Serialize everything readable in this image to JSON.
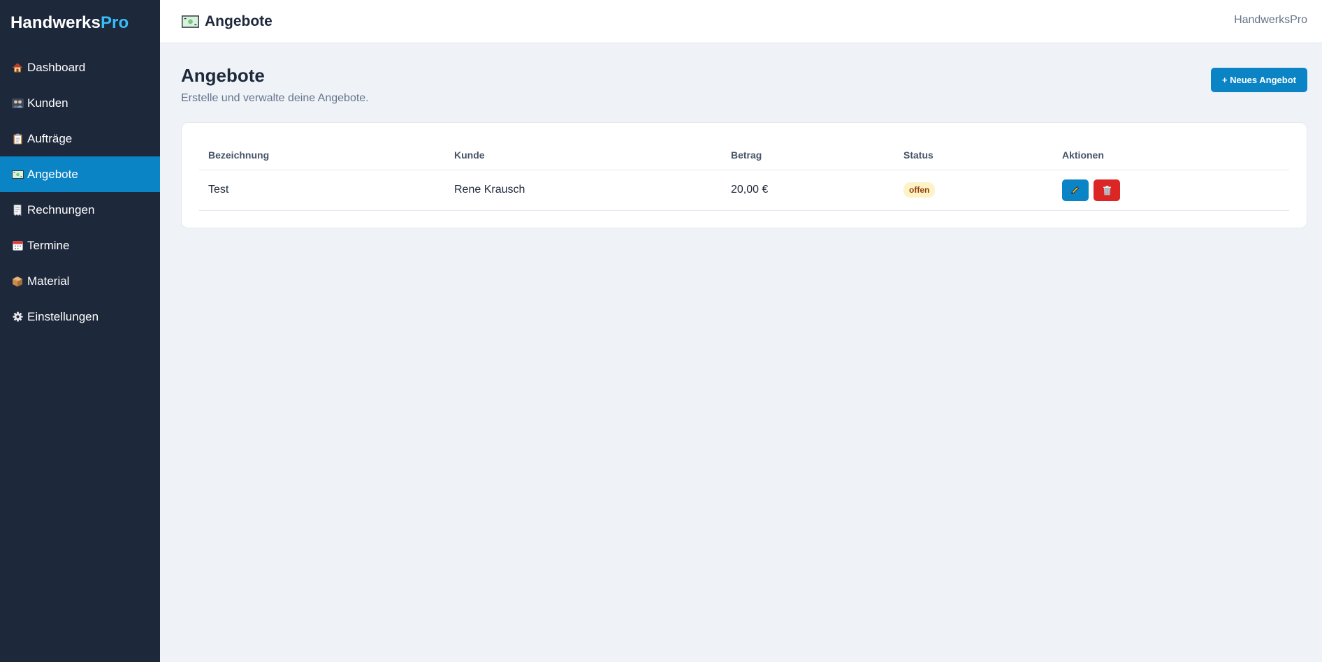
{
  "brand": {
    "main": "Handwerks",
    "accent": "Pro"
  },
  "sidebar": {
    "items": [
      {
        "label": "Dashboard",
        "icon": "house-icon",
        "active": false
      },
      {
        "label": "Kunden",
        "icon": "people-icon",
        "active": false
      },
      {
        "label": "Aufträge",
        "icon": "clipboard-icon",
        "active": false
      },
      {
        "label": "Angebote",
        "icon": "money-icon",
        "active": true
      },
      {
        "label": "Rechnungen",
        "icon": "receipt-icon",
        "active": false
      },
      {
        "label": "Termine",
        "icon": "calendar-icon",
        "active": false
      },
      {
        "label": "Material",
        "icon": "box-icon",
        "active": false
      },
      {
        "label": "Einstellungen",
        "icon": "gear-icon",
        "active": false
      }
    ]
  },
  "topbar": {
    "title": "Angebote",
    "icon": "money-icon",
    "app_name": "HandwerksPro"
  },
  "page": {
    "title": "Angebote",
    "subtitle": "Erstelle und verwalte deine Angebote.",
    "new_button": "+ Neues Angebot"
  },
  "table": {
    "columns": [
      "Bezeichnung",
      "Kunde",
      "Betrag",
      "Status",
      "Aktionen"
    ],
    "rows": [
      {
        "bezeichnung": "Test",
        "kunde": "Rene Krausch",
        "betrag": "20,00 €",
        "status": "offen"
      }
    ]
  },
  "colors": {
    "sidebar_bg": "#1e283b",
    "accent": "#0b84c6",
    "brand_accent": "#38bdf8",
    "danger": "#dc2626",
    "badge_bg": "#fef3c7"
  }
}
